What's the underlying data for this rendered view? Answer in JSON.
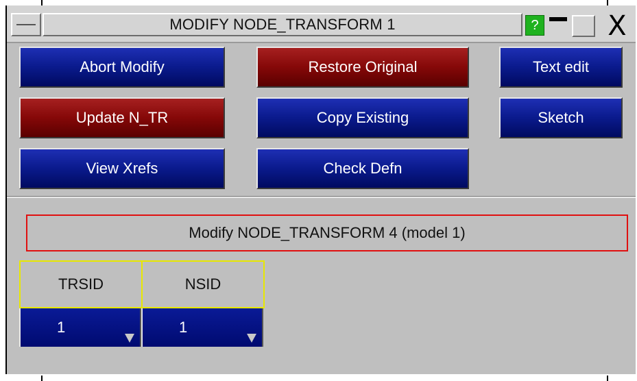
{
  "window": {
    "title": "MODIFY NODE_TRANSFORM 1",
    "help_label": "?",
    "close_label": "X"
  },
  "actions": {
    "abort_modify": "Abort Modify",
    "restore_original": "Restore Original",
    "text_edit": "Text edit",
    "update": "Update N_TR",
    "copy_existing": "Copy Existing",
    "sketch": "Sketch",
    "view_xrefs": "View Xrefs",
    "check_defn": "Check Defn"
  },
  "header": {
    "label": "Modify NODE_TRANSFORM 4 (model 1)"
  },
  "table": {
    "columns": [
      "TRSID",
      "NSID"
    ],
    "values": [
      "1",
      "1"
    ]
  },
  "colors": {
    "button_blue": "#0a1a8c",
    "button_red": "#850808",
    "header_border": "#e01010",
    "column_border": "#e8e800",
    "help_green": "#1fb21f"
  }
}
